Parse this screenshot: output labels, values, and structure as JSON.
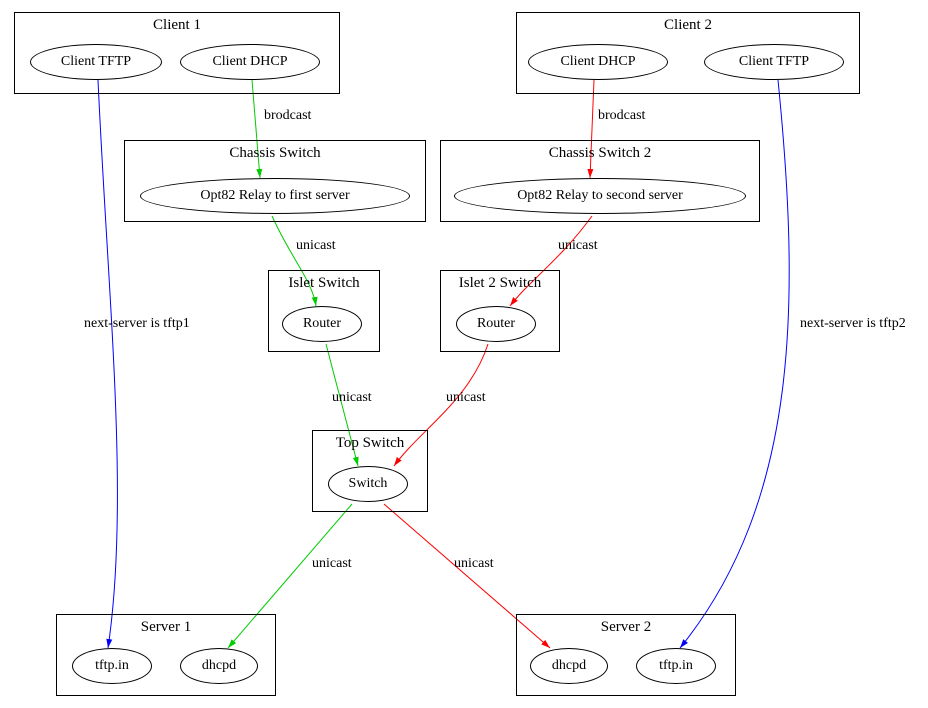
{
  "clusters": {
    "client1": {
      "title": "Client 1"
    },
    "client2": {
      "title": "Client 2"
    },
    "chassis1": {
      "title": "Chassis Switch"
    },
    "chassis2": {
      "title": "Chassis Switch 2"
    },
    "islet1": {
      "title": "Islet Switch"
    },
    "islet2": {
      "title": "Islet 2 Switch"
    },
    "top": {
      "title": "Top Switch"
    },
    "server1": {
      "title": "Server 1"
    },
    "server2": {
      "title": "Server 2"
    }
  },
  "nodes": {
    "c1_tftp": "Client TFTP",
    "c1_dhcp": "Client DHCP",
    "c2_dhcp": "Client DHCP",
    "c2_tftp": "Client TFTP",
    "opt82_1": "Opt82 Relay to first server",
    "opt82_2": "Opt82 Relay to second server",
    "router1": "Router",
    "router2": "Router",
    "switch": "Switch",
    "s1_tftp": "tftp.in",
    "s1_dhcpd": "dhcpd",
    "s2_dhcpd": "dhcpd",
    "s2_tftp": "tftp.in"
  },
  "edges": {
    "brodcast1": "brodcast",
    "brodcast2": "brodcast",
    "unicast1": "unicast",
    "unicast2": "unicast",
    "unicast3": "unicast",
    "unicast4": "unicast",
    "unicast5": "unicast",
    "unicast6": "unicast",
    "nextserver1": "next-server is tftp1",
    "nextserver2": "next-server is tftp2"
  },
  "colors": {
    "green": "#00cc00",
    "red": "#ff0000",
    "blue": "#0000ff"
  }
}
